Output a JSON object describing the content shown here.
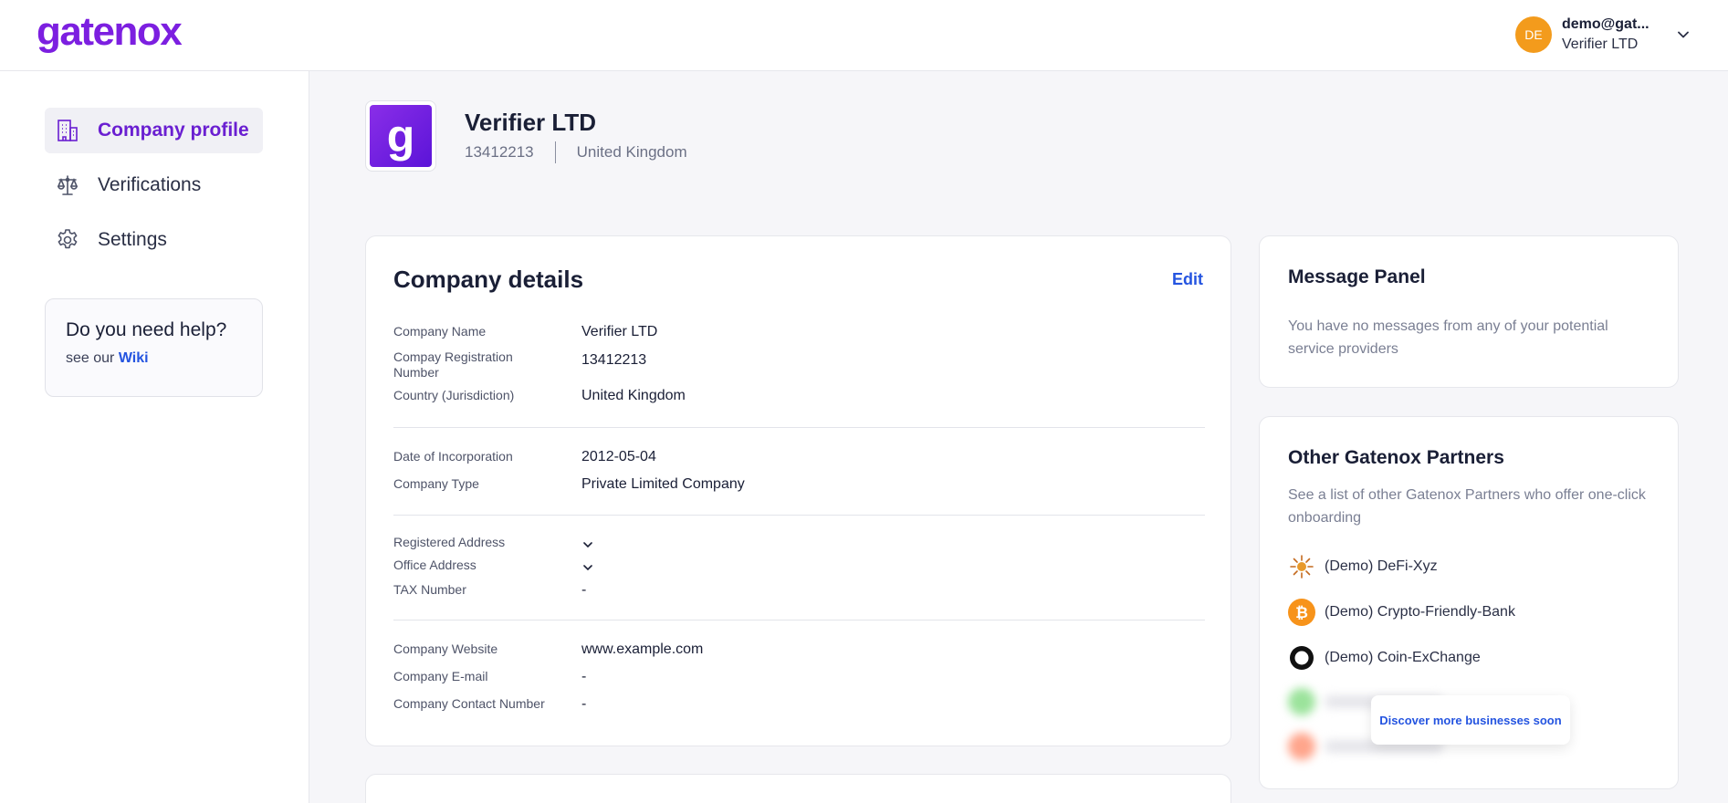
{
  "header": {
    "logo": "gatenox",
    "user_initials": "DE",
    "user_email": "demo@gat...",
    "user_company": "Verifier LTD"
  },
  "sidebar": {
    "items": [
      {
        "label": "Company profile",
        "icon": "building-icon",
        "active": true
      },
      {
        "label": "Verifications",
        "icon": "scale-icon",
        "active": false
      },
      {
        "label": "Settings",
        "icon": "gear-icon",
        "active": false
      }
    ],
    "help": {
      "title": "Do you need help?",
      "prefix": "see our",
      "link": "Wiki"
    }
  },
  "company": {
    "logo_letter": "g",
    "name": "Verifier LTD",
    "number": "13412213",
    "country": "United Kingdom"
  },
  "details": {
    "title": "Company details",
    "edit_label": "Edit",
    "rows": {
      "name": {
        "label": "Company Name",
        "value": "Verifier LTD"
      },
      "reg": {
        "label": "Compay Registration Number",
        "value": "13412213"
      },
      "country": {
        "label": "Country (Jurisdiction)",
        "value": "United Kingdom"
      },
      "incorp": {
        "label": "Date of Incorporation",
        "value": "2012-05-04"
      },
      "type": {
        "label": "Company Type",
        "value": "Private Limited Company"
      },
      "reg_addr": {
        "label": "Registered Address"
      },
      "office_addr": {
        "label": "Office Address"
      },
      "tax": {
        "label": "TAX Number",
        "value": "-"
      },
      "website": {
        "label": "Company Website",
        "value": "www.example.com"
      },
      "email": {
        "label": "Company E-mail",
        "value": "-"
      },
      "phone": {
        "label": "Company Contact Number",
        "value": "-"
      }
    }
  },
  "message_panel": {
    "title": "Message Panel",
    "text": "You have no messages from any of your potential service providers"
  },
  "partners": {
    "title": "Other Gatenox Partners",
    "text": "See a list of other Gatenox Partners who offer one-click onboarding",
    "items": [
      {
        "name": "(Demo) DeFi-Xyz",
        "icon": "sun-icon"
      },
      {
        "name": "(Demo) Crypto-Friendly-Bank",
        "icon": "bitcoin-icon"
      },
      {
        "name": "(Demo) Coin-ExChange",
        "icon": "ring-icon"
      }
    ],
    "discover_label": "Discover more businesses soon"
  },
  "colors": {
    "brand": "#7c1fe0",
    "link": "#2454e0",
    "avatar": "#f39b1c"
  }
}
